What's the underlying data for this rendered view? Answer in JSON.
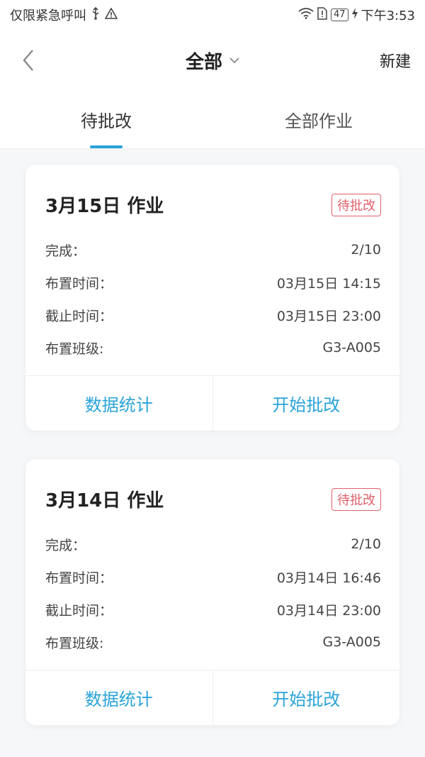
{
  "status_bar": {
    "left_text": "仅限紧急呼叫",
    "battery": "47",
    "time": "下午3:53"
  },
  "nav": {
    "title": "全部",
    "right_action": "新建"
  },
  "tabs": [
    {
      "label": "待批改",
      "active": true
    },
    {
      "label": "全部作业",
      "active": false
    }
  ],
  "cards": [
    {
      "title": "3月15日 作业",
      "badge": "待批改",
      "rows": [
        {
          "label": "完成：",
          "value": "2/10"
        },
        {
          "label": "布置时间：",
          "value": "03月15日 14:15"
        },
        {
          "label": "截止时间：",
          "value": "03月15日 23:00"
        },
        {
          "label": "布置班级:",
          "value": "G3-A005"
        }
      ],
      "actions": [
        "数据统计",
        "开始批改"
      ]
    },
    {
      "title": "3月14日 作业",
      "badge": "待批改",
      "rows": [
        {
          "label": "完成：",
          "value": "2/10"
        },
        {
          "label": "布置时间：",
          "value": "03月14日 16:46"
        },
        {
          "label": "截止时间：",
          "value": "03月14日 23:00"
        },
        {
          "label": "布置班级:",
          "value": "G3-A005"
        }
      ],
      "actions": [
        "数据统计",
        "开始批改"
      ]
    }
  ],
  "colors": {
    "accent": "#2aa3d8",
    "badge_red": "#e0606a",
    "background": "#f5f7f9"
  }
}
